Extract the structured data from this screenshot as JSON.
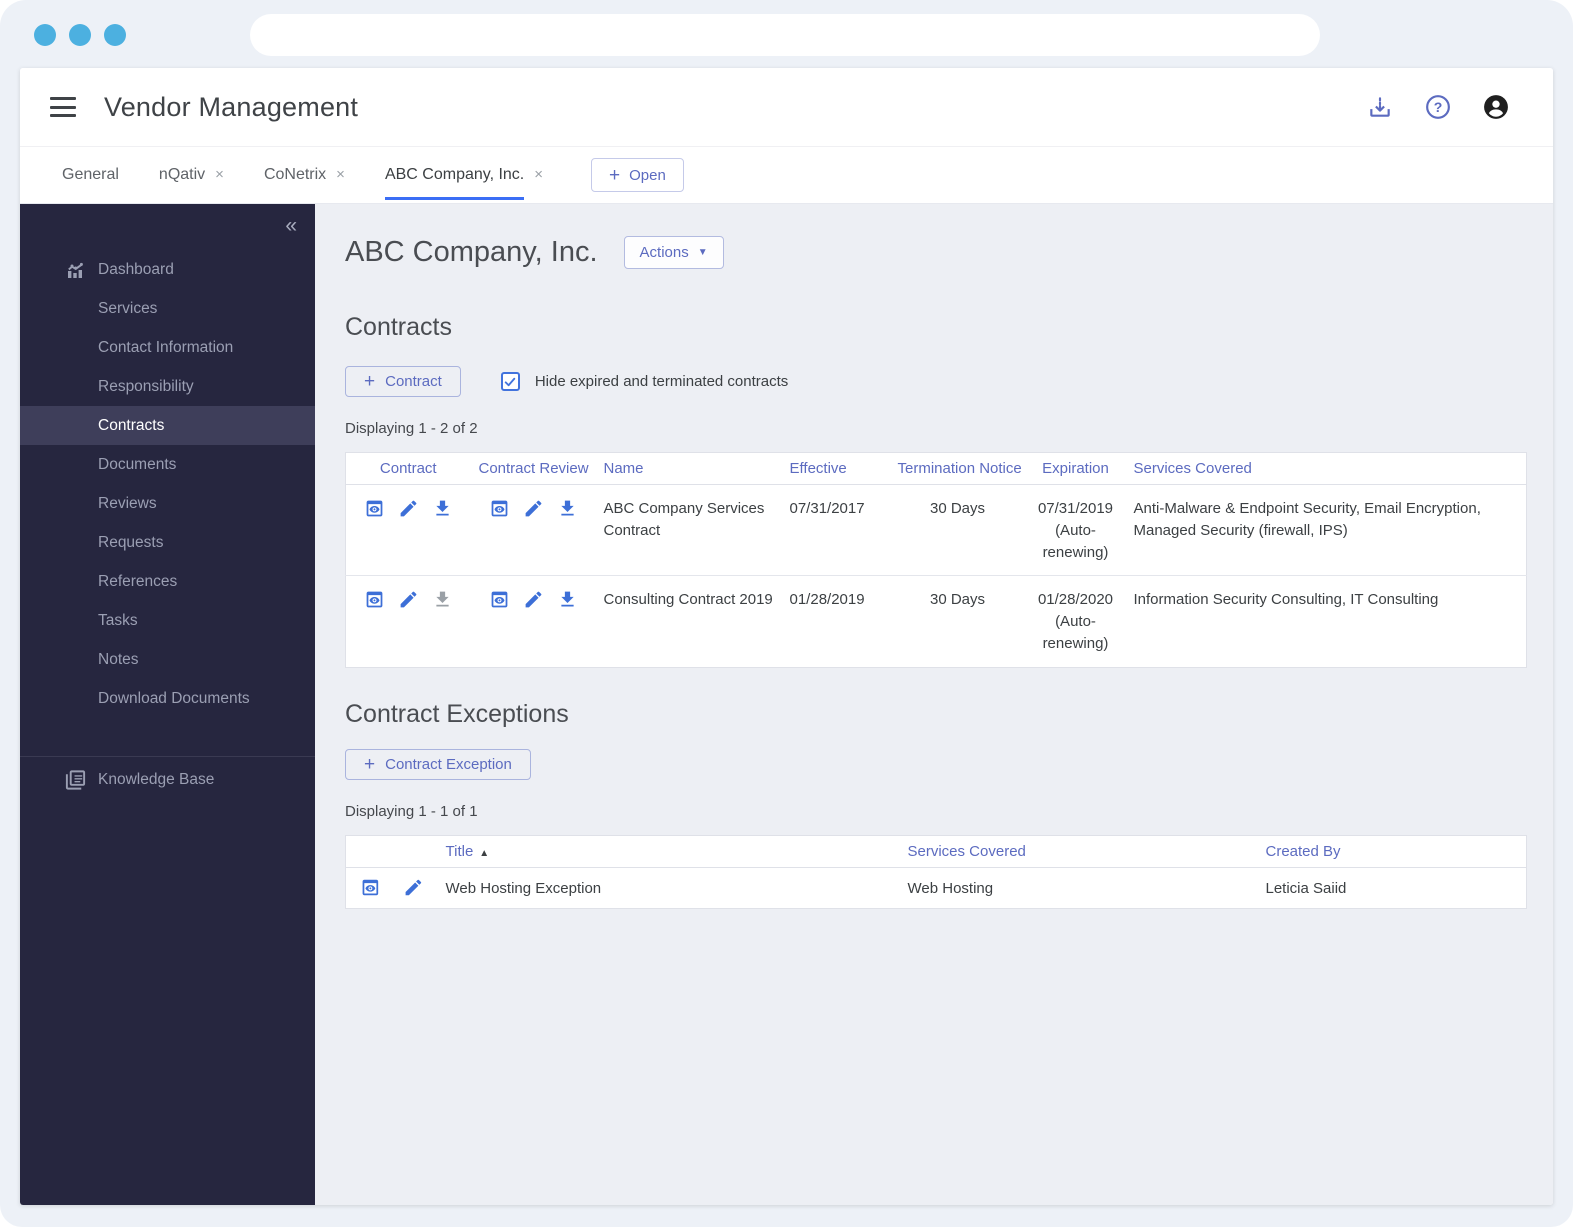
{
  "colors": {
    "chrome_bg": "#edf1f7",
    "dot_blue": "#4cb0e0",
    "sidebar_bg": "#26263f",
    "sidebar_active_bg": "#3e3e5a",
    "indigo_accent": "#5c6bc0",
    "action_blue": "#3d6fd7",
    "tab_underline": "#3b6ef5",
    "content_bg": "#edeff4"
  },
  "header": {
    "title": "Vendor Management",
    "icons": [
      "download-icon",
      "help-icon",
      "account-icon"
    ]
  },
  "tabs": {
    "items": [
      {
        "label": "General",
        "closable": false,
        "active": false
      },
      {
        "label": "nQativ",
        "closable": true,
        "active": false
      },
      {
        "label": "CoNetrix",
        "closable": true,
        "active": false
      },
      {
        "label": "ABC Company, Inc.",
        "closable": true,
        "active": true
      }
    ],
    "close_glyph": "×",
    "open_button": "Open"
  },
  "sidebar": {
    "items": [
      {
        "label": "Dashboard",
        "icon": "dashboard-icon",
        "active": false
      },
      {
        "label": "Services",
        "active": false
      },
      {
        "label": "Contact Information",
        "active": false
      },
      {
        "label": "Responsibility",
        "active": false
      },
      {
        "label": "Contracts",
        "active": true
      },
      {
        "label": "Documents",
        "active": false
      },
      {
        "label": "Reviews",
        "active": false
      },
      {
        "label": "Requests",
        "active": false
      },
      {
        "label": "References",
        "active": false
      },
      {
        "label": "Tasks",
        "active": false
      },
      {
        "label": "Notes",
        "active": false
      },
      {
        "label": "Download Documents",
        "active": false
      }
    ],
    "active_item": "Contracts",
    "footer_item": {
      "label": "Knowledge Base",
      "icon": "knowledge-base-icon"
    }
  },
  "main": {
    "page_title": "ABC Company, Inc.",
    "actions_label": "Actions",
    "contracts": {
      "heading": "Contracts",
      "add_button": "Contract",
      "filter_label": "Hide expired and terminated contracts",
      "filter_checked": true,
      "displaying": "Displaying 1 - 2 of 2",
      "columns": {
        "contract": "Contract",
        "contract_review": "Contract Review",
        "name": "Name",
        "effective": "Effective",
        "termination": "Termination Notice",
        "expiration": "Expiration",
        "services": "Services Covered"
      },
      "rows": [
        {
          "name": "ABC Company Services Contract",
          "effective": "07/31/2017",
          "termination": "30 Days",
          "expiration_date": "07/31/2019",
          "expiration_note": "(Auto-renewing)",
          "services": "Anti-Malware & Endpoint Security, Email Encryption, Managed Security (firewall, IPS)",
          "contract_download_enabled": true
        },
        {
          "name": "Consulting Contract 2019",
          "effective": "01/28/2019",
          "termination": "30 Days",
          "expiration_date": "01/28/2020",
          "expiration_note": "(Auto-renewing)",
          "services": "Information Security Consulting, IT Consulting",
          "contract_download_enabled": false
        }
      ]
    },
    "exceptions": {
      "heading": "Contract Exceptions",
      "add_button": "Contract Exception",
      "displaying": "Displaying 1 - 1 of 1",
      "columns": {
        "title": "Title",
        "services": "Services Covered",
        "created_by": "Created By"
      },
      "sort": {
        "column": "Title",
        "direction": "asc",
        "glyph": "▲"
      },
      "rows": [
        {
          "title": "Web Hosting Exception",
          "services": "Web Hosting",
          "created_by": "Leticia Saiid"
        }
      ]
    }
  }
}
